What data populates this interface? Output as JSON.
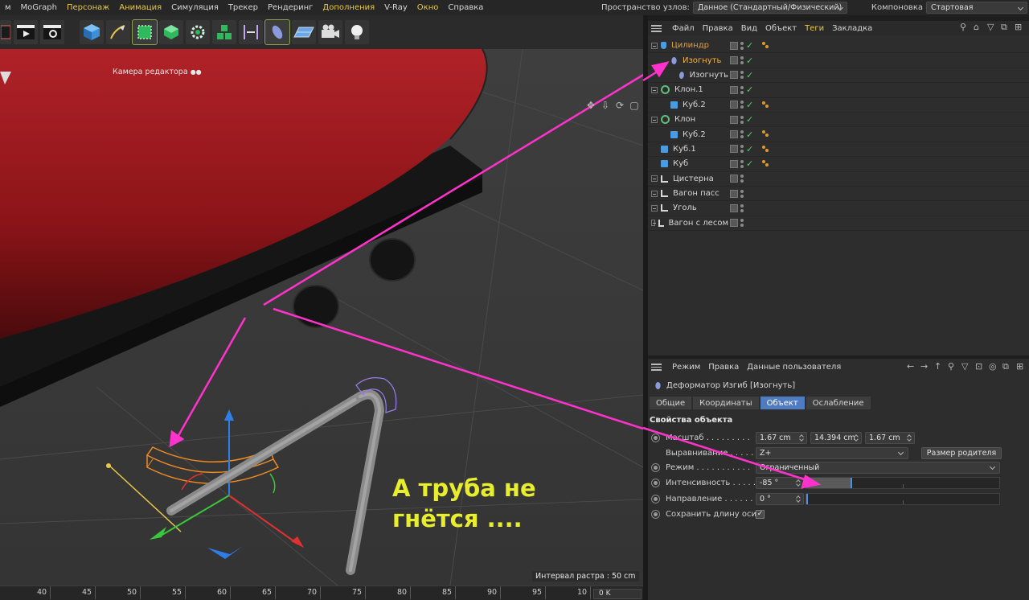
{
  "menubar": {
    "items": [
      {
        "label": "м",
        "hl": false
      },
      {
        "label": "MoGraph",
        "hl": false
      },
      {
        "label": "Персонаж",
        "hl": true
      },
      {
        "label": "Анимация",
        "hl": true
      },
      {
        "label": "Симуляция",
        "hl": false
      },
      {
        "label": "Трекер",
        "hl": false
      },
      {
        "label": "Рендеринг",
        "hl": false
      },
      {
        "label": "Дополнения",
        "hl": true
      },
      {
        "label": "V-Ray",
        "hl": false
      },
      {
        "label": "Окно",
        "hl": true
      },
      {
        "label": "Справка",
        "hl": false
      }
    ],
    "node_space_label": "Пространство узлов:",
    "node_space_value": "Данное (Стандартный/Физический)",
    "layout_label": "Компоновка",
    "layout_value": "Стартовая"
  },
  "toolbar": {
    "icons": [
      "render-region-icon",
      "render-view-icon",
      "render-settings-icon",
      "cube-primitive-icon",
      "pen-spline-icon",
      "subdivision-icon",
      "extrude-generator-icon",
      "cloner-icon",
      "mograph-icon",
      "symmetry-icon",
      "bend-deformer-icon",
      "floor-icon",
      "camera-icon",
      "light-icon"
    ]
  },
  "viewport": {
    "camera_label": "Камера редактора",
    "raster_label": "Интервал растра : 50 cm",
    "note_line1": "А труба не",
    "note_line2": "гнётся ....",
    "colors": {
      "tank": "#8b1418",
      "arrow": "#ff33cc",
      "note": "#e8ee2c",
      "deformer": "#f08a20"
    }
  },
  "timeline": {
    "ticks": [
      "40",
      "45",
      "50",
      "55",
      "60",
      "65",
      "70",
      "75",
      "80",
      "85",
      "90",
      "95",
      "10"
    ],
    "frame": "0 K"
  },
  "object_manager": {
    "menu": [
      {
        "label": "Файл",
        "hl": false
      },
      {
        "label": "Правка",
        "hl": false
      },
      {
        "label": "Вид",
        "hl": false
      },
      {
        "label": "Объект",
        "hl": false
      },
      {
        "label": "Теги",
        "hl": true
      },
      {
        "label": "Закладка",
        "hl": false
      }
    ],
    "objects": [
      {
        "name": "Цилиндр",
        "icon": "cyl",
        "indent": 0,
        "state": "hl",
        "check": true,
        "tags": true,
        "expander": true
      },
      {
        "name": "Изогнуть",
        "icon": "bend",
        "indent": 1,
        "state": "hl2",
        "check": true,
        "tags": false,
        "expander": false
      },
      {
        "name": "Изогнуть",
        "icon": "bend",
        "indent": 2,
        "state": "",
        "check": true,
        "tags": false,
        "expander": false
      },
      {
        "name": "Клон.1",
        "icon": "clone",
        "indent": 0,
        "state": "",
        "check": true,
        "tags": false,
        "expander": true
      },
      {
        "name": "Куб.2",
        "icon": "cube",
        "indent": 1,
        "state": "",
        "check": true,
        "tags": true,
        "expander": false
      },
      {
        "name": "Клон",
        "icon": "clone",
        "indent": 0,
        "state": "",
        "check": true,
        "tags": false,
        "expander": true
      },
      {
        "name": "Куб.2",
        "icon": "cube",
        "indent": 1,
        "state": "",
        "check": true,
        "tags": true,
        "expander": false
      },
      {
        "name": "Куб.1",
        "icon": "cube",
        "indent": 0,
        "state": "",
        "check": true,
        "tags": true,
        "expander": false
      },
      {
        "name": "Куб",
        "icon": "cube",
        "indent": 0,
        "state": "",
        "check": true,
        "tags": true,
        "expander": false
      },
      {
        "name": "Цистерна",
        "icon": "null",
        "indent": 0,
        "state": "",
        "check": false,
        "tags": false,
        "expander": true
      },
      {
        "name": "Вагон пасс",
        "icon": "null",
        "indent": 0,
        "state": "",
        "check": false,
        "tags": false,
        "expander": true
      },
      {
        "name": "Уголь",
        "icon": "null",
        "indent": 0,
        "state": "",
        "check": false,
        "tags": false,
        "expander": true
      },
      {
        "name": "Вагон с лесом",
        "icon": "null",
        "indent": 0,
        "state": "",
        "check": false,
        "tags": false,
        "expander": true
      }
    ]
  },
  "attribute_manager": {
    "menu": [
      "Режим",
      "Правка",
      "Данные пользователя"
    ],
    "title": "Деформатор Изгиб [Изогнуть]",
    "tabs": [
      {
        "label": "Общие",
        "active": false
      },
      {
        "label": "Координаты",
        "active": false
      },
      {
        "label": "Объект",
        "active": true
      },
      {
        "label": "Ослабление",
        "active": false
      }
    ],
    "section": "Свойства объекта",
    "size_label": "Масштаб . . . . . . . . .",
    "size_x": "1.67 cm",
    "size_y": "14.394 cm",
    "size_z": "1.67 cm",
    "align_label": "Выравнивание . . . . . .",
    "align_value": "Z+",
    "parent_size_button": "Размер родителя",
    "mode_label": "Режим . . . . . . . . . . .",
    "mode_value": "Ограниченный",
    "strength_label": "Интенсивность . . . . .",
    "strength_value": "-85 °",
    "strength_level": 0.23,
    "angle_label": "Направление . . . . . .",
    "angle_value": "0 °",
    "angle_level": 0,
    "keep_length_label": "Сохранить длину оси Y",
    "keep_length_checked": true
  }
}
